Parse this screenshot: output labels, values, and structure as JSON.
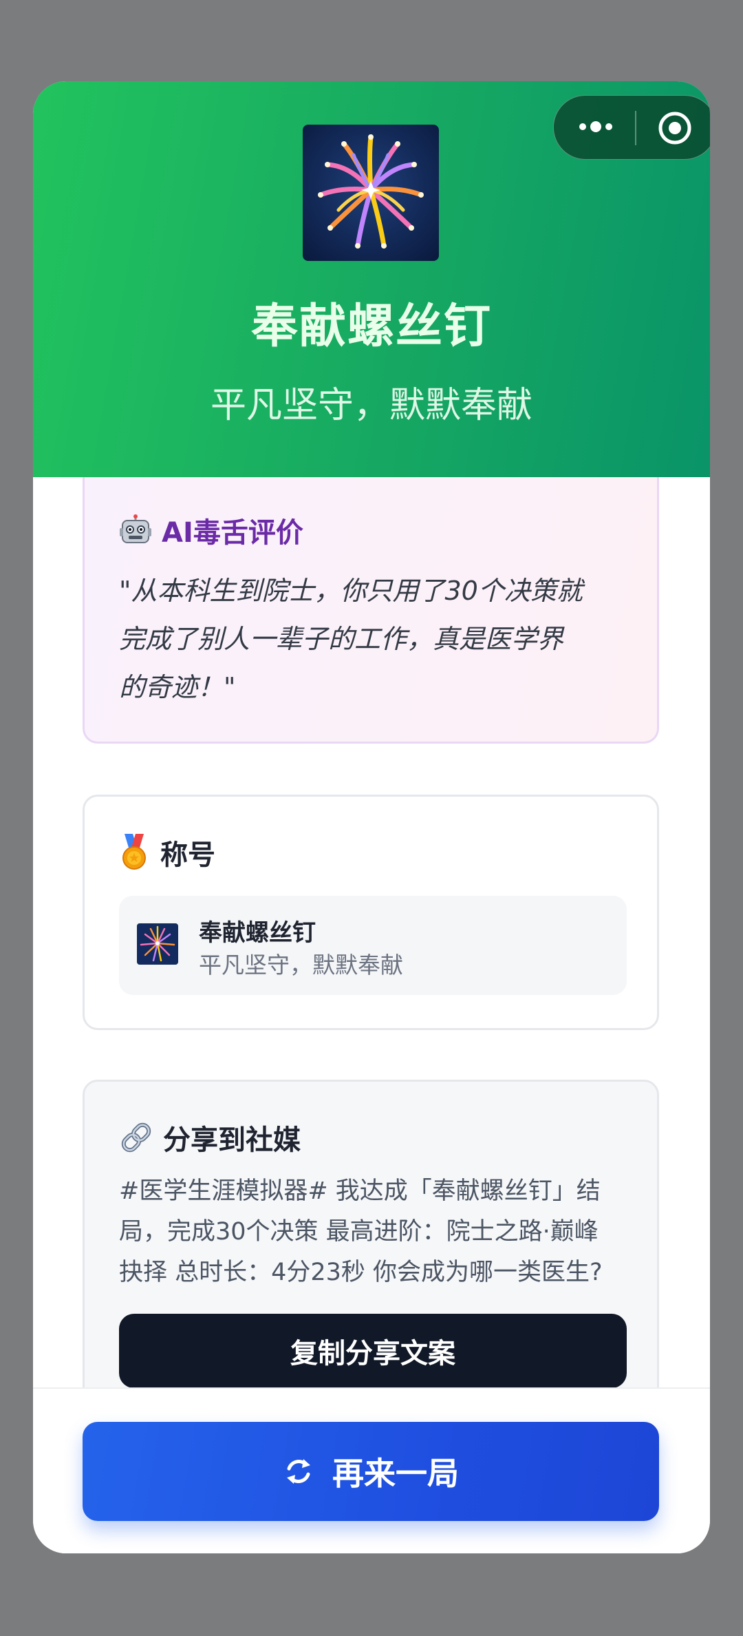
{
  "header": {
    "title": "奉献螺丝钉",
    "subtitle": "平凡坚守，默默奉献",
    "icon": "fireworks-icon"
  },
  "capsule": {
    "more_icon": "more-dots-icon",
    "close_icon": "close-target-icon"
  },
  "ai_review": {
    "icon": "robot-icon",
    "heading": "AI毒舌评价",
    "quote_lines": [
      "\"从本科生到院士，你只用了30个决策就",
      "完成了别人一辈子的工作，真是医学界",
      "的奇迹！\""
    ]
  },
  "title_section": {
    "icon": "medal-icon",
    "heading": "称号",
    "badge": {
      "icon": "fireworks-icon",
      "name": "奉献螺丝钉",
      "desc": "平凡坚守，默默奉献"
    }
  },
  "share_section": {
    "icon": "link-icon",
    "heading": "分享到社媒",
    "text_lines": [
      "#医学生涯模拟器# 我达成「奉献螺丝钉」结",
      "局，完成30个决策 最高进阶：院士之路·巅峰",
      "抉择 总时长：4分23秒 你会成为哪一类医生?"
    ],
    "copy_label": "复制分享文案"
  },
  "footer": {
    "again_icon": "refresh-icon",
    "again_label": "再来一局"
  },
  "colors": {
    "header_green": "#16a862",
    "ai_purple": "#6b2aa6",
    "copy_button": "#111827",
    "again_button": "#2563eb"
  }
}
